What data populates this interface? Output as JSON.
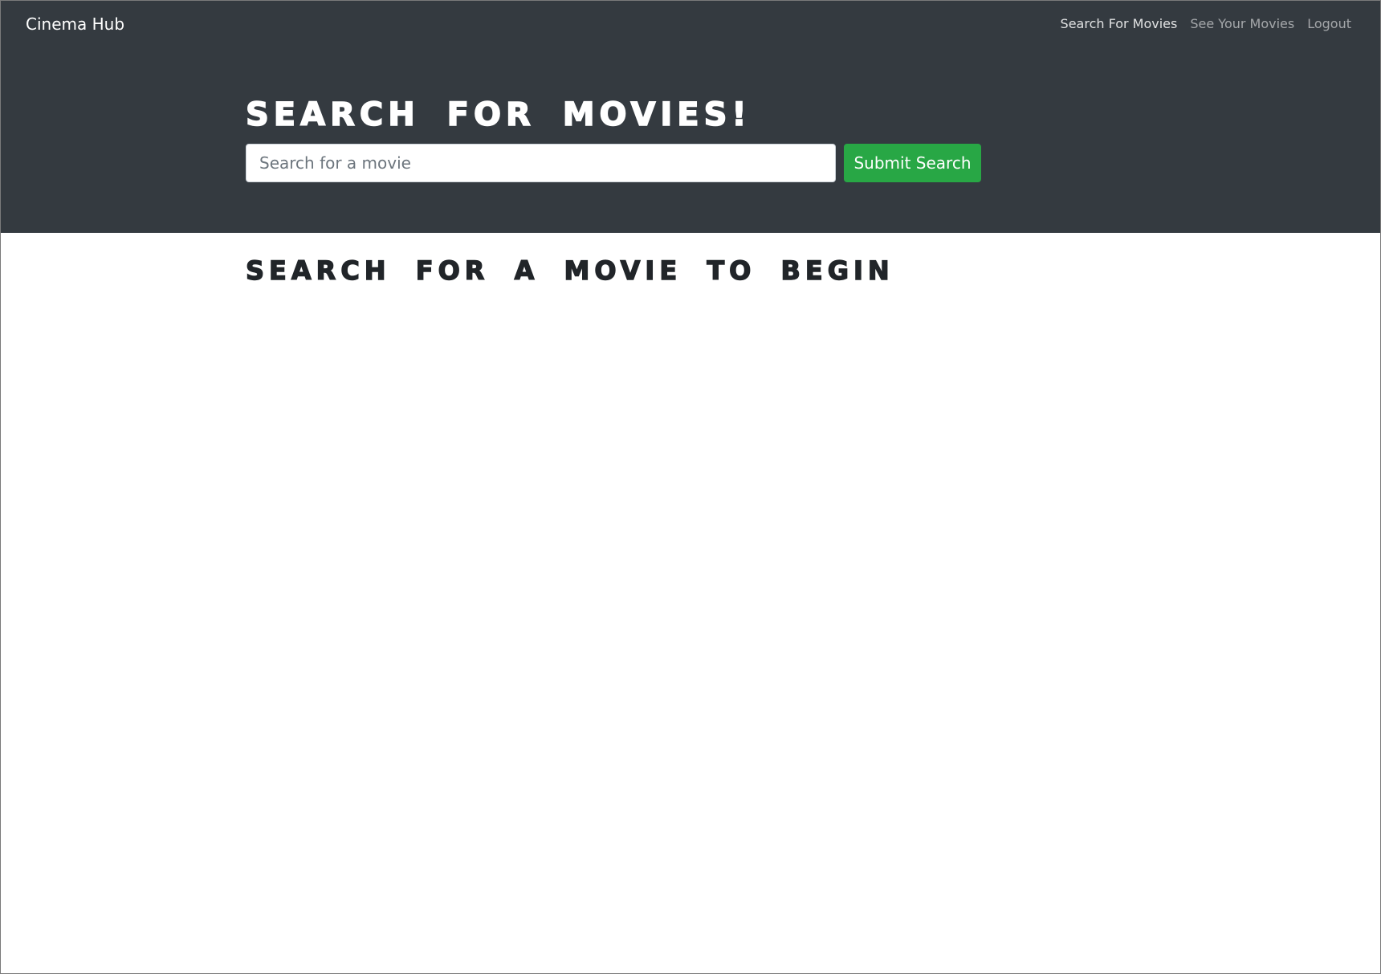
{
  "navbar": {
    "brand": "Cinema Hub",
    "links": [
      {
        "label": "Search For Movies",
        "active": true
      },
      {
        "label": "See Your Movies",
        "active": false
      },
      {
        "label": "Logout",
        "active": false
      }
    ]
  },
  "hero": {
    "title": "Search for Movies!",
    "search": {
      "placeholder": "Search for a movie",
      "value": ""
    },
    "submit_label": "Submit Search"
  },
  "main": {
    "heading": "Search for a movie to begin"
  },
  "colors": {
    "hero_background": "#343a40",
    "submit_button": "#28a745",
    "heading_text": "#212529"
  }
}
